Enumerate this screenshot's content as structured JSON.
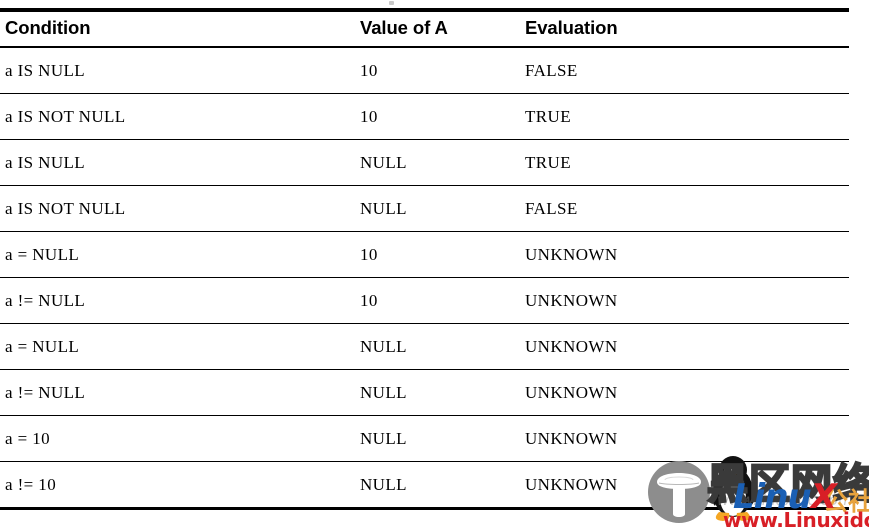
{
  "table": {
    "headers": [
      "Condition",
      "Value of A",
      "Evaluation"
    ],
    "rows": [
      {
        "condition": "a IS NULL",
        "value": "10",
        "evaluation": "FALSE"
      },
      {
        "condition": "a IS NOT NULL",
        "value": "10",
        "evaluation": "TRUE"
      },
      {
        "condition": "a IS NULL",
        "value": "NULL",
        "evaluation": "TRUE"
      },
      {
        "condition": "a IS NOT NULL",
        "value": "NULL",
        "evaluation": "FALSE"
      },
      {
        "condition": "a = NULL",
        "value": "10",
        "evaluation": "UNKNOWN"
      },
      {
        "condition": "a != NULL",
        "value": "10",
        "evaluation": "UNKNOWN"
      },
      {
        "condition": "a = NULL",
        "value": "NULL",
        "evaluation": "UNKNOWN"
      },
      {
        "condition": "a != NULL",
        "value": "NULL",
        "evaluation": "UNKNOWN"
      },
      {
        "condition": "a = 10",
        "value": "NULL",
        "evaluation": "UNKNOWN"
      },
      {
        "condition": "a != 10",
        "value": "NULL",
        "evaluation": "UNKNOWN"
      }
    ]
  },
  "watermark": {
    "chinese_site": "黑区网络",
    "brand_linu": "Linu",
    "brand_x": "X",
    "gongshe": "公社",
    "url": "www.Linuxidc.com",
    "faint_url": "www.linuxidc.com",
    "colors": {
      "blue": "#1a5fb4",
      "red": "#d81f26",
      "orange": "#e8a33d",
      "gray": "#808080"
    }
  }
}
